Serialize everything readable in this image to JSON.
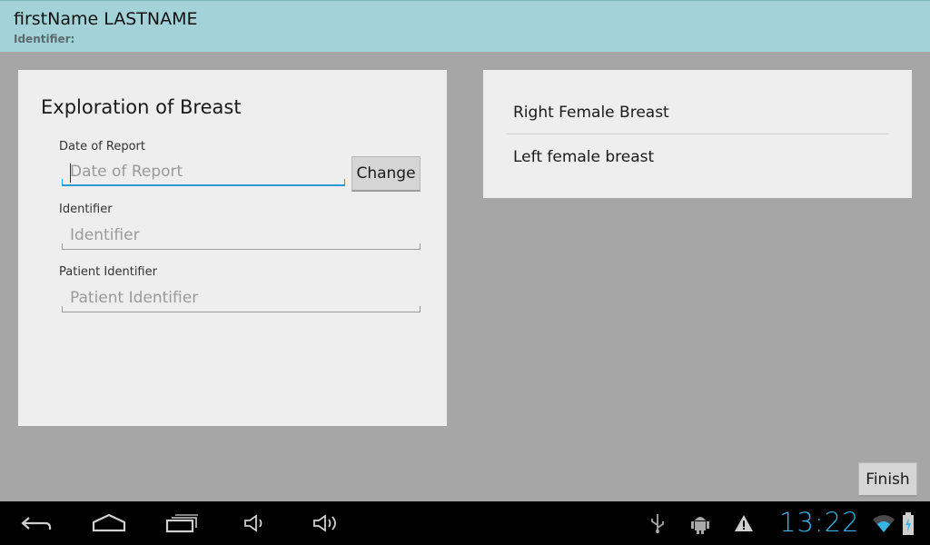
{
  "header": {
    "patient_name": "firstName LASTNAME",
    "identifier_label": "Identifier:"
  },
  "form": {
    "title": "Exploration of Breast",
    "fields": [
      {
        "label": "Date of Report",
        "placeholder": "Date of Report",
        "value": ""
      },
      {
        "label": "Identifier",
        "placeholder": "Identifier",
        "value": ""
      },
      {
        "label": "Patient Identifier",
        "placeholder": "Patient Identifier",
        "value": ""
      }
    ],
    "change_label": "Change"
  },
  "list": {
    "items": [
      "Right Female Breast",
      "Left female breast"
    ]
  },
  "finish_label": "Finish",
  "system_bar": {
    "time": "13:22",
    "accent_color": "#33b5e5",
    "icons": [
      "back-icon",
      "home-icon",
      "recent-apps-icon",
      "volume-down-icon",
      "volume-up-icon",
      "usb-icon",
      "android-debug-icon",
      "warning-icon",
      "wifi-icon",
      "battery-charging-icon"
    ]
  }
}
